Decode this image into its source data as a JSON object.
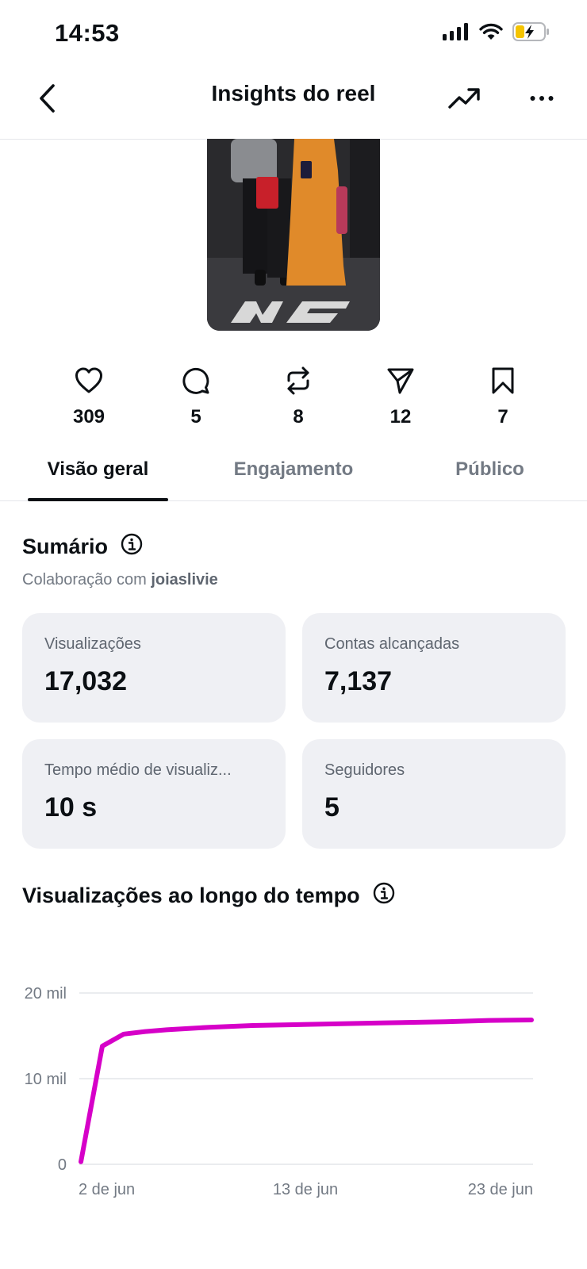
{
  "status_bar": {
    "time": "14:53"
  },
  "nav": {
    "title": "Insights do reel"
  },
  "stats": [
    {
      "icon": "heart-icon",
      "value": "309"
    },
    {
      "icon": "comment-icon",
      "value": "5"
    },
    {
      "icon": "repost-icon",
      "value": "8"
    },
    {
      "icon": "share-icon",
      "value": "12"
    },
    {
      "icon": "bookmark-icon",
      "value": "7"
    }
  ],
  "tabs": [
    {
      "label": "Visão geral",
      "active": true
    },
    {
      "label": "Engajamento",
      "active": false
    },
    {
      "label": "Público",
      "active": false
    }
  ],
  "summary": {
    "title": "Sumário",
    "collab_prefix": "Colaboração com",
    "collab_user": "joiaslivie",
    "cards": [
      {
        "label": "Visualizações",
        "value": "17,032"
      },
      {
        "label": "Contas alcançadas",
        "value": "7,137"
      },
      {
        "label": "Tempo médio de visualiz...",
        "value": "10 s"
      },
      {
        "label": "Seguidores",
        "value": "5"
      }
    ]
  },
  "views_over_time": {
    "title": "Visualizações ao longo do tempo"
  },
  "colors": {
    "line": "#d600c8",
    "card_bg": "#eff0f4",
    "text_muted": "#737a84"
  },
  "chart_data": {
    "type": "line",
    "title": "Visualizações ao longo do tempo",
    "xlabel": "",
    "ylabel": "",
    "x_tick_labels": [
      "2 de jun",
      "13 de jun",
      "23 de jun"
    ],
    "y_tick_labels": [
      "20 mil",
      "10 mil",
      "0"
    ],
    "ylim": [
      0,
      20000
    ],
    "grid": true,
    "series": [
      {
        "x": [
          "2 de jun",
          "3 de jun",
          "4 de jun",
          "5 de jun",
          "6 de jun",
          "8 de jun",
          "10 de jun",
          "13 de jun",
          "16 de jun",
          "19 de jun",
          "21 de jun",
          "23 de jun"
        ],
        "values": [
          300,
          13800,
          15200,
          15500,
          15700,
          16000,
          16200,
          16350,
          16500,
          16650,
          16800,
          16850
        ]
      }
    ]
  }
}
